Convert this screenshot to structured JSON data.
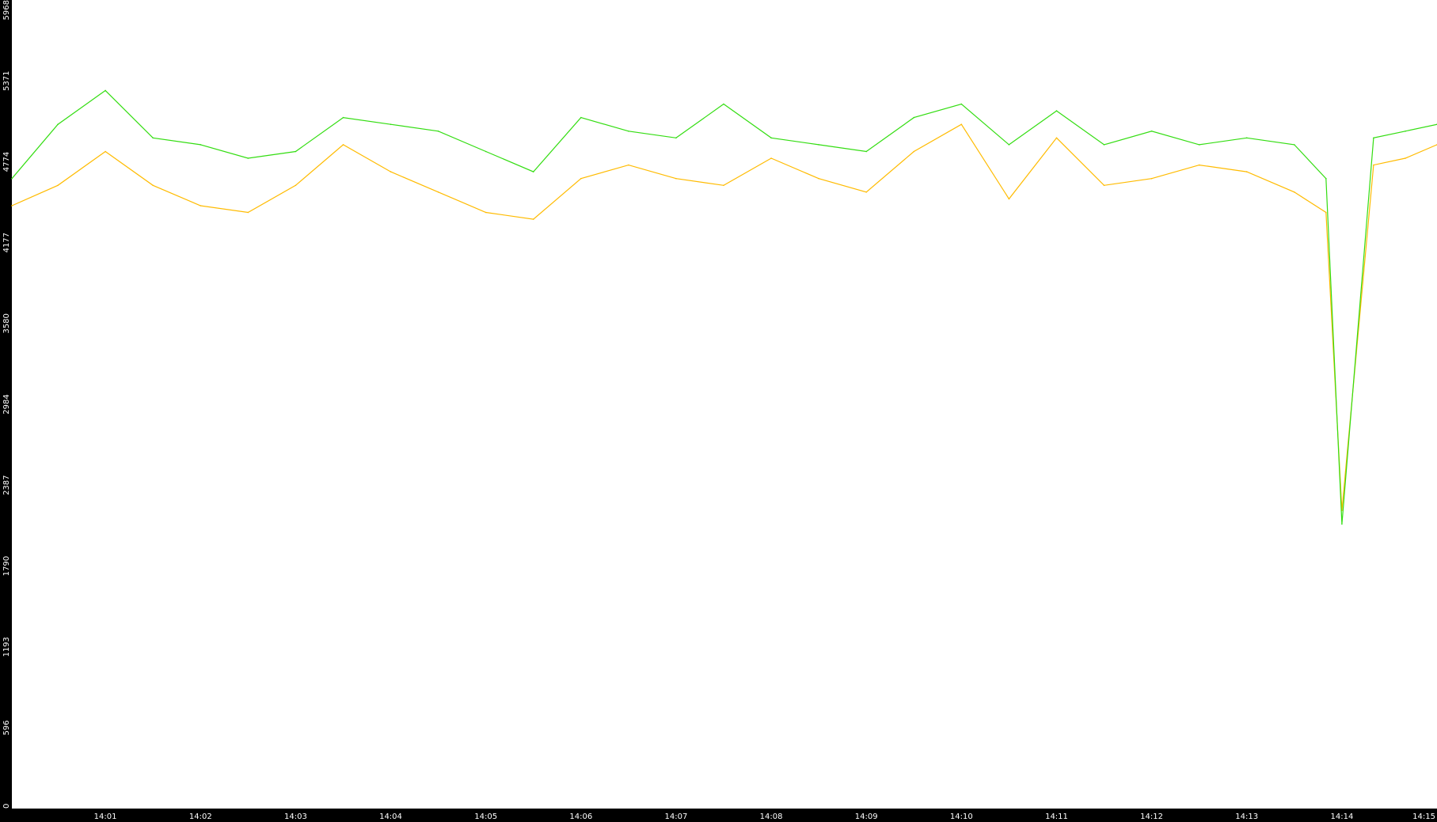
{
  "chart_data": {
    "type": "line",
    "title": "",
    "xlabel": "",
    "ylabel": "",
    "y_ticks": [
      "0",
      "596",
      "1193",
      "1790",
      "2387",
      "2984",
      "3580",
      "4177",
      "4774",
      "5371",
      "5968"
    ],
    "ylim": [
      0,
      5968
    ],
    "x_ticks": [
      "14:01",
      "14:02",
      "14:03",
      "14:04",
      "14:05",
      "14:06",
      "14:07",
      "14:08",
      "14:09",
      "14:10",
      "14:11",
      "14:12",
      "14:13",
      "14:14",
      "14:15"
    ],
    "xlim": [
      "14:00:01",
      "14:15:00"
    ],
    "grid": false,
    "legend": "none",
    "colors": {
      "background": "#000000",
      "plot_area": "#ffffff",
      "axis_text": "#ffffff"
    },
    "series": [
      {
        "color": "#ffbb00",
        "x": [
          "14:00:01",
          "14:00:30",
          "14:01:00",
          "14:01:30",
          "14:02:00",
          "14:02:30",
          "14:03:00",
          "14:03:30",
          "14:04:00",
          "14:04:30",
          "14:05:00",
          "14:05:30",
          "14:06:00",
          "14:06:30",
          "14:07:00",
          "14:07:30",
          "14:08:00",
          "14:08:30",
          "14:09:00",
          "14:09:30",
          "14:10:00",
          "14:10:30",
          "14:11:00",
          "14:11:30",
          "14:12:00",
          "14:12:30",
          "14:13:00",
          "14:13:30",
          "14:13:50",
          "14:14:00",
          "14:14:20",
          "14:14:40",
          "14:15:00"
        ],
        "values": [
          4450,
          4600,
          4850,
          4600,
          4450,
          4400,
          4600,
          4900,
          4700,
          4550,
          4400,
          4350,
          4650,
          4750,
          4650,
          4600,
          4800,
          4650,
          4550,
          4850,
          5050,
          4500,
          4950,
          4600,
          4650,
          4750,
          4700,
          4550,
          4400,
          2200,
          4750,
          4800,
          4900
        ]
      },
      {
        "color": "#33dd11",
        "x": [
          "14:00:01",
          "14:00:30",
          "14:01:00",
          "14:01:30",
          "14:02:00",
          "14:02:30",
          "14:03:00",
          "14:03:30",
          "14:04:00",
          "14:04:30",
          "14:05:00",
          "14:05:30",
          "14:06:00",
          "14:06:30",
          "14:07:00",
          "14:07:30",
          "14:08:00",
          "14:08:30",
          "14:09:00",
          "14:09:30",
          "14:10:00",
          "14:10:30",
          "14:11:00",
          "14:11:30",
          "14:12:00",
          "14:12:30",
          "14:13:00",
          "14:13:30",
          "14:13:50",
          "14:14:00",
          "14:14:20",
          "14:14:40",
          "14:15:00"
        ],
        "values": [
          4650,
          5050,
          5300,
          4950,
          4900,
          4800,
          4850,
          5100,
          5050,
          5000,
          4850,
          4700,
          5100,
          5000,
          4950,
          5200,
          4950,
          4900,
          4850,
          5100,
          5200,
          4900,
          5150,
          4900,
          5000,
          4900,
          4950,
          4900,
          4650,
          2100,
          4950,
          5000,
          5050
        ]
      }
    ]
  }
}
